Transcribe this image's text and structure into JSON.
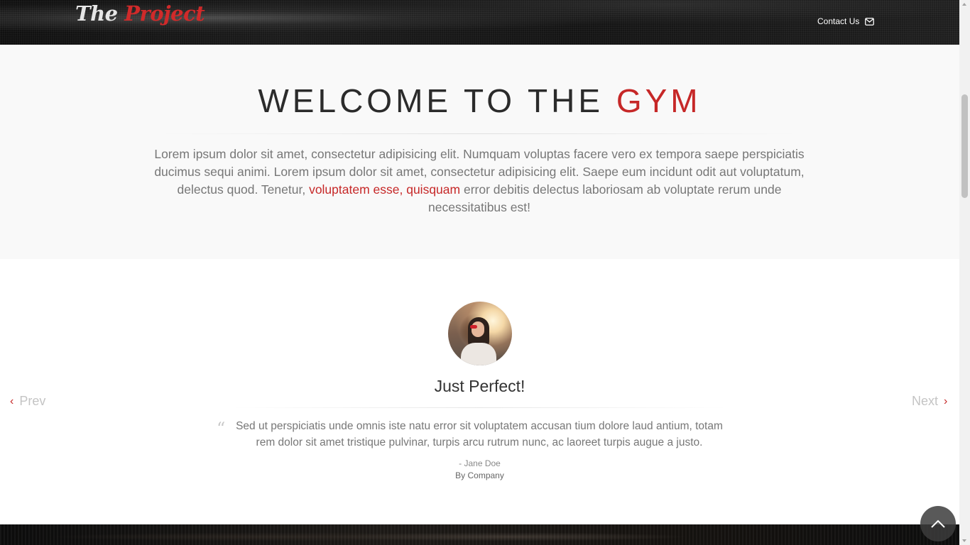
{
  "header": {
    "logo_part1": "The ",
    "logo_part2": "Project",
    "contact_label": "Contact Us",
    "contact_icon": "envelope-icon"
  },
  "welcome": {
    "title_main": "WELCOME TO THE ",
    "title_accent": "GYM",
    "paragraph_before": "Lorem ipsum dolor sit amet, consectetur adipisicing elit. Numquam voluptas facere vero ex tempora saepe perspiciatis ducimus sequi animi. Lorem ipsum dolor sit amet, consectetur adipisicing elit. Saepe eum incidunt odit aut voluptatum, delectus quod. Tenetur, ",
    "paragraph_link": "voluptatem esse, quisquam",
    "paragraph_after": " error debitis delectus laboriosam ab voluptate rerum unde necessitatibus est!"
  },
  "testimonial": {
    "title": "Just Perfect!",
    "quote_mark": "“",
    "text": "Sed ut perspiciatis unde omnis iste natu error sit voluptatem accusan tium dolore laud antium, totam rem dolor sit amet tristique pulvinar, turpis arcu rutrum nunc, ac laoreet turpis augue a justo.",
    "author": "- Jane Doe",
    "company": "By Company"
  },
  "carousel": {
    "prev_label": "Prev",
    "next_label": "Next",
    "prev_icon": "chevron-left-icon",
    "next_icon": "chevron-right-icon"
  },
  "colors": {
    "accent": "#c62828",
    "header_bg": "#151515",
    "section_bg": "#f9f9f9"
  }
}
